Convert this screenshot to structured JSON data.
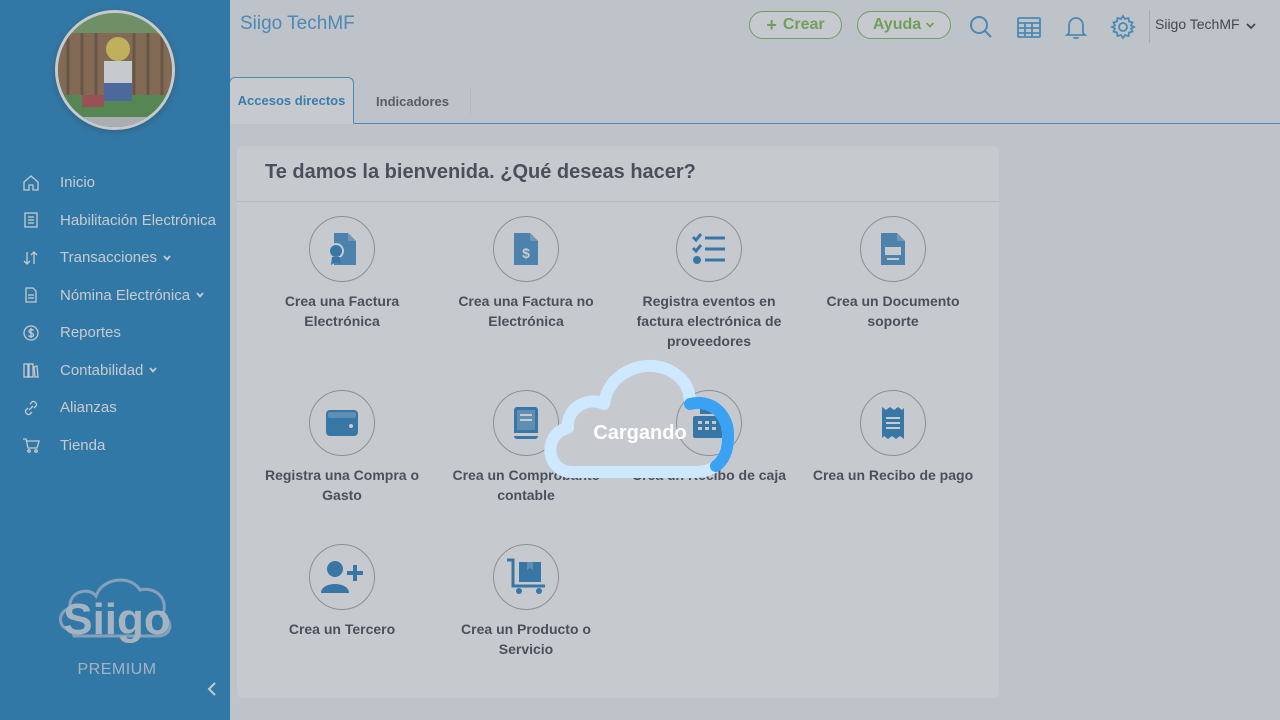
{
  "header": {
    "title": "Siigo TechMF",
    "create_label": "Crear",
    "create_prefix": "+",
    "help_label": "Ayuda",
    "user_name": "Siigo TechMF",
    "icons": [
      "search-icon",
      "calendar-icon",
      "bell-icon",
      "gear-icon"
    ]
  },
  "sidebar": {
    "items": [
      {
        "label": "Inicio",
        "icon": "home-icon"
      },
      {
        "label": "Habilitación Electrónica",
        "icon": "receipt-icon"
      },
      {
        "label": "Transacciones",
        "icon": "transactions-icon",
        "has_submenu": true
      },
      {
        "label": "Nómina Electrónica",
        "icon": "document-icon",
        "has_submenu": true
      },
      {
        "label": "Reportes",
        "icon": "dollar-icon"
      },
      {
        "label": "Contabilidad",
        "icon": "ledger-icon",
        "has_submenu": true
      },
      {
        "label": "Alianzas",
        "icon": "link-icon"
      },
      {
        "label": "Tienda",
        "icon": "cart-icon"
      }
    ],
    "logo_text": "Siigo",
    "logo_sub": "PREMIUM"
  },
  "tabs": [
    {
      "label": "Accesos directos",
      "active": true
    },
    {
      "label": "Indicadores",
      "active": false
    }
  ],
  "welcome": {
    "title": "Te damos la bienvenida. ¿Qué deseas hacer?",
    "actions": [
      {
        "label": "Crea una Factura Electrónica",
        "icon": "certificate-document-icon"
      },
      {
        "label": "Crea una Factura no Electrónica",
        "icon": "dollar-document-icon"
      },
      {
        "label": "Registra eventos en factura electrónica de proveedores",
        "icon": "checklist-icon"
      },
      {
        "label": "Crea un Documento soporte",
        "icon": "support-document-icon"
      },
      {
        "label": "Registra una Compra o Gasto",
        "icon": "wallet-icon"
      },
      {
        "label": "Crea un Comprobante contable",
        "icon": "book-icon"
      },
      {
        "label": "Crea un Recibo de caja",
        "icon": "cash-register-icon"
      },
      {
        "label": "Crea un Recibo de pago",
        "icon": "payment-receipt-icon"
      },
      {
        "label": "Crea un Tercero",
        "icon": "add-user-icon"
      },
      {
        "label": "Crea un Producto o Servicio",
        "icon": "product-cart-icon"
      }
    ]
  },
  "loading": {
    "text": "Cargando"
  },
  "colors": {
    "sidebar": "#0073b9",
    "accent": "#2e8fd1",
    "green": "#6fb33b",
    "icon_fill": "#0b6fb8"
  }
}
